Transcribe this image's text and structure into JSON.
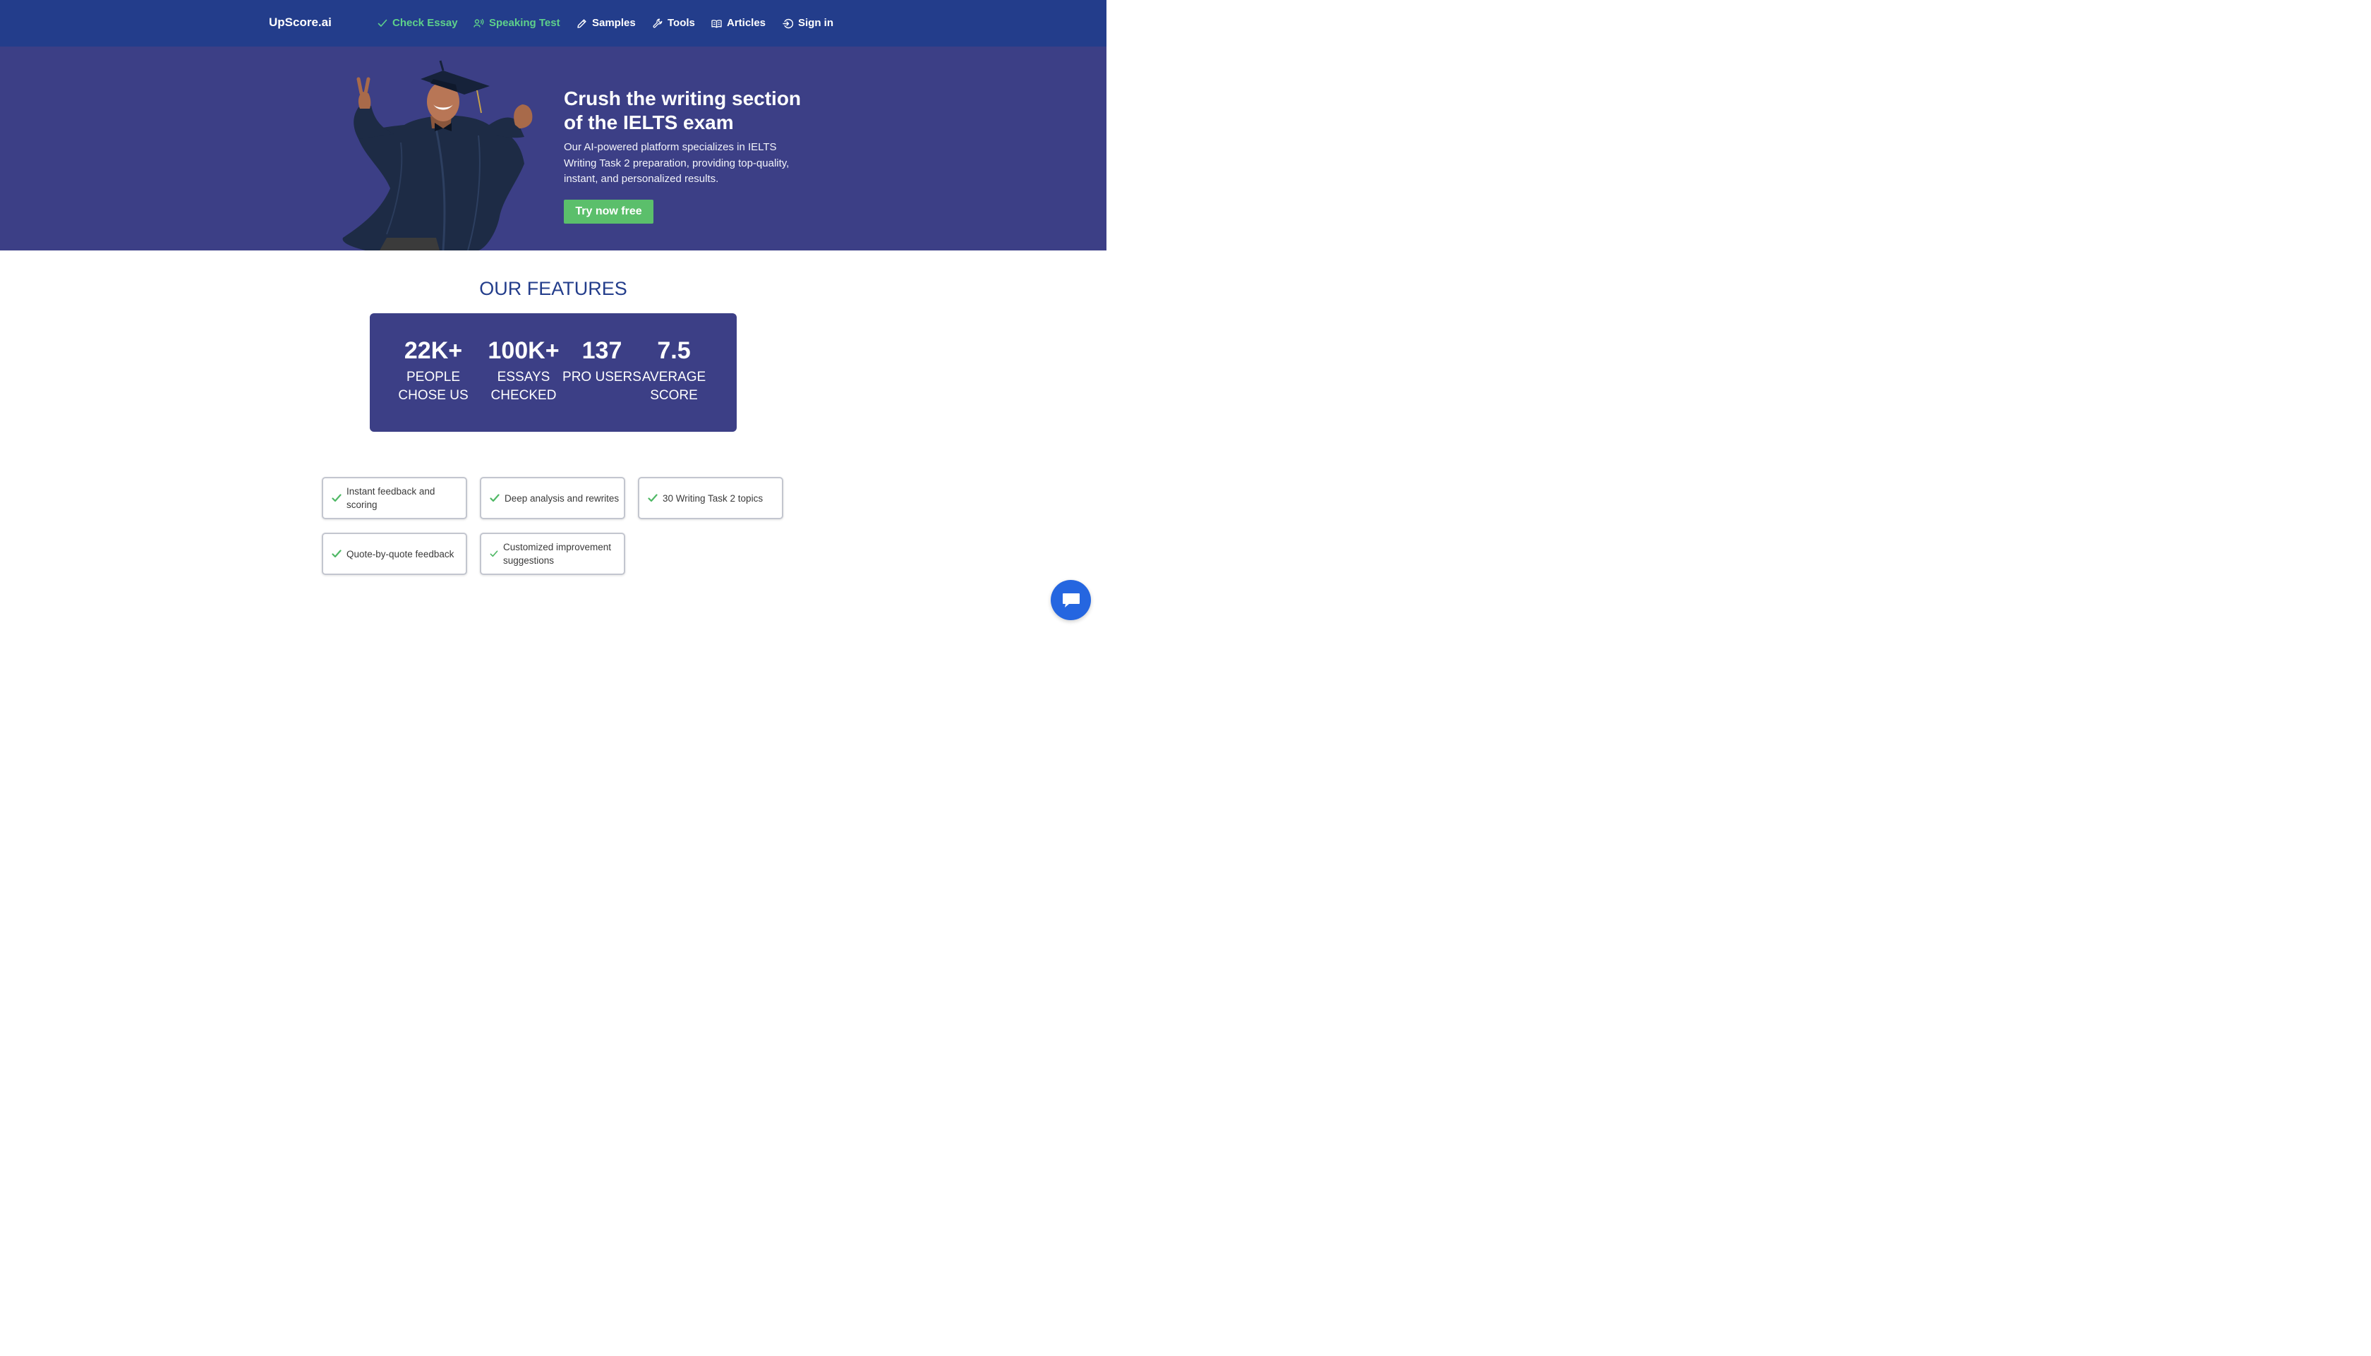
{
  "nav": {
    "brand": "UpScore.ai",
    "items": [
      {
        "label": "Check Essay",
        "icon": "check-icon",
        "color": "#5ed18a"
      },
      {
        "label": "Speaking Test",
        "icon": "speaking-icon",
        "color": "#5ed18a"
      },
      {
        "label": "Samples",
        "icon": "pencil-icon",
        "color": "#ffffff"
      },
      {
        "label": "Tools",
        "icon": "wrench-icon",
        "color": "#ffffff"
      },
      {
        "label": "Articles",
        "icon": "book-icon",
        "color": "#ffffff"
      },
      {
        "label": "Sign in",
        "icon": "sign-in-icon",
        "color": "#ffffff"
      }
    ]
  },
  "hero": {
    "title": "Crush the writing section of the IELTS exam",
    "description": "Our AI-powered platform specializes in IELTS Writing Task 2 preparation, providing top-quality, instant, and personalized results.",
    "cta": "Try now free"
  },
  "features": {
    "heading": "OUR FEATURES",
    "stats": [
      {
        "value": "22K+",
        "label": "People chose us"
      },
      {
        "value": "100K+",
        "label": "Essays checked"
      },
      {
        "value": "137",
        "label": "Pro users"
      },
      {
        "value": "7.5",
        "label": "Average score"
      }
    ],
    "items": [
      "Instant feedback and scoring",
      "Deep analysis and rewrites",
      "30 Writing Task 2 topics",
      "Quote-by-quote feedback",
      "Customized improvement suggestions"
    ]
  },
  "colors": {
    "nav_bg": "#233d8b",
    "hero_bg": "#3c3f86",
    "accent_green": "#5bbf6b",
    "chat_blue": "#2566e0"
  }
}
